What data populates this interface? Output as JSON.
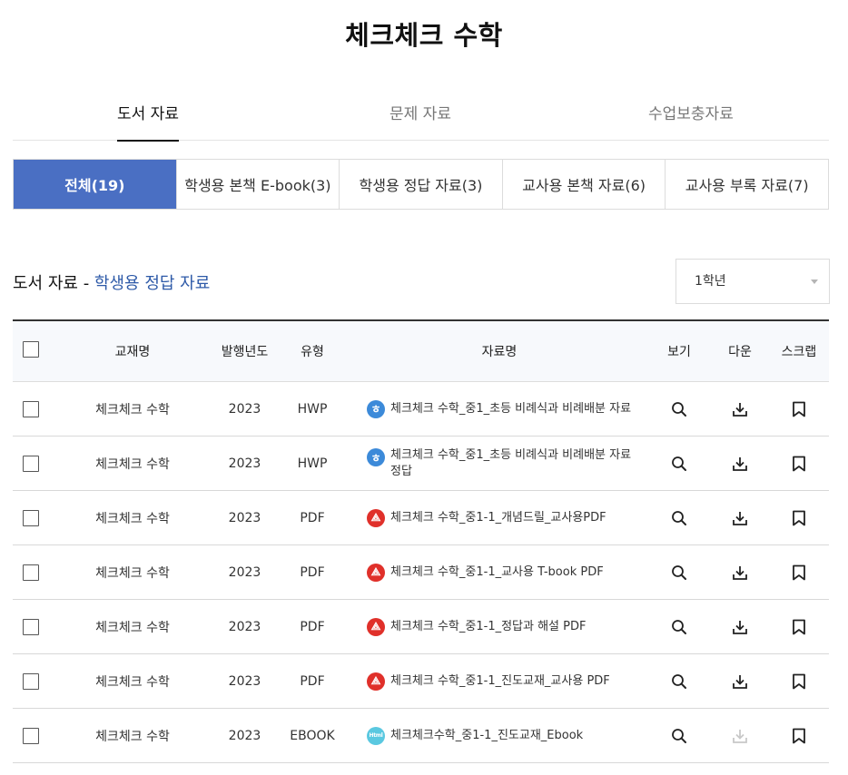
{
  "page": {
    "title": "체크체크 수학"
  },
  "main_tabs": [
    {
      "label": "도서 자료",
      "active": true
    },
    {
      "label": "문제 자료",
      "active": false
    },
    {
      "label": "수업보충자료",
      "active": false
    }
  ],
  "sub_tabs": [
    {
      "label": "전체(19)",
      "active": true
    },
    {
      "label": "학생용 본책 E-book(3)",
      "active": false
    },
    {
      "label": "학생용 정답 자료(3)",
      "active": false
    },
    {
      "label": "교사용 본책 자료(6)",
      "active": false
    },
    {
      "label": "교사용 부록 자료(7)",
      "active": false
    }
  ],
  "section": {
    "prefix": "도서 자료",
    "separator": " - ",
    "category": "학생용 정답 자료"
  },
  "grade_select": {
    "selected": "1학년"
  },
  "table": {
    "headers": {
      "book": "교재명",
      "year": "발행년도",
      "type": "유형",
      "name": "자료명",
      "view": "보기",
      "download": "다운",
      "scrap": "스크랩"
    },
    "rows": [
      {
        "book": "체크체크 수학",
        "year": "2023",
        "type": "HWP",
        "icon": "hwp-icon",
        "name": "체크체크 수학_중1_초등 비례식과 비례배분 자료",
        "download_enabled": true
      },
      {
        "book": "체크체크 수학",
        "year": "2023",
        "type": "HWP",
        "icon": "hwp-icon",
        "name": "체크체크 수학_중1_초등 비례식과 비례배분 자료 정답",
        "download_enabled": true
      },
      {
        "book": "체크체크 수학",
        "year": "2023",
        "type": "PDF",
        "icon": "pdf-icon",
        "name": "체크체크 수학_중1-1_개념드릴_교사용PDF",
        "download_enabled": true
      },
      {
        "book": "체크체크 수학",
        "year": "2023",
        "type": "PDF",
        "icon": "pdf-icon",
        "name": "체크체크 수학_중1-1_교사용 T-book PDF",
        "download_enabled": true
      },
      {
        "book": "체크체크 수학",
        "year": "2023",
        "type": "PDF",
        "icon": "pdf-icon",
        "name": "체크체크 수학_중1-1_정답과 해설 PDF",
        "download_enabled": true
      },
      {
        "book": "체크체크 수학",
        "year": "2023",
        "type": "PDF",
        "icon": "pdf-icon",
        "name": "체크체크 수학_중1-1_진도교재_교사용 PDF",
        "download_enabled": true
      },
      {
        "book": "체크체크 수학",
        "year": "2023",
        "type": "EBOOK",
        "icon": "html-icon",
        "name": "체크체크수학_중1-1_진도교재_Ebook",
        "download_enabled": false
      }
    ]
  },
  "colors": {
    "accent": "#4a6fc3",
    "section_accent": "#2e5aa8",
    "hwp": "#3c8ad9",
    "pdf": "#e0302a",
    "html": "#5ac8e0",
    "disabled": "#c8c8c8"
  }
}
